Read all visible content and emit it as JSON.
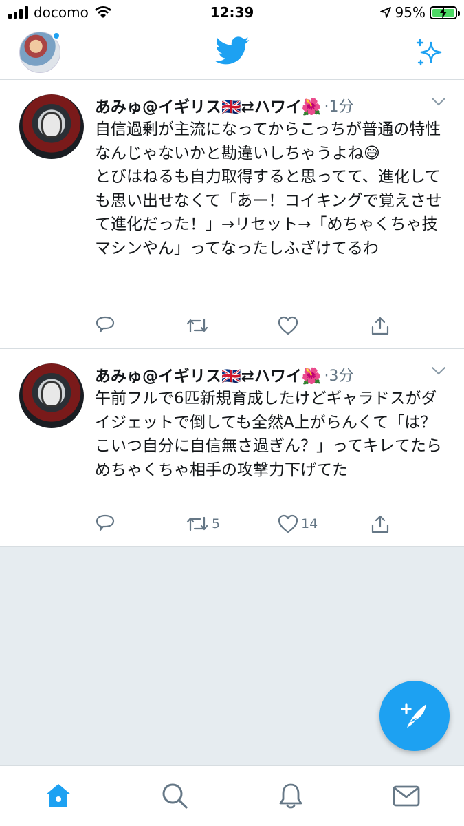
{
  "status_bar": {
    "carrier": "docomo",
    "time": "12:39",
    "battery_percent": "95%"
  },
  "header": {
    "logo": "twitter-bird-icon",
    "right_icon": "sparkle-icon"
  },
  "tweets": [
    {
      "display_name": "あみゅ@イギリス🇬🇧⇄ハワイ🌺",
      "timestamp": "·1分",
      "text": "自信過剰が主流になってからこっちが普通の特性なんじゃないかと勘違いしちゃうよね😅\nとびはねるも自力取得すると思ってて、進化しても思い出せなくて「あー！コイキングで覚えさせて進化だった！」→リセット→「めちゃくちゃ技マシンやん」ってなったしふざけてるわ",
      "retweets": "",
      "likes": ""
    },
    {
      "display_name": "あみゅ@イギリス🇬🇧⇄ハワイ🌺",
      "timestamp": "·3分",
      "text": "午前フルで6匹新規育成したけどギャラドスがダイジェットで倒しても全然A上がらんくて「は？こいつ自分に自信無さ過ぎん？」ってキレてたらめちゃくちゃ相手の攻撃力下げてた",
      "retweets": "5",
      "likes": "14"
    }
  ],
  "tab_bar": {
    "items": [
      "home-icon",
      "search-icon",
      "notifications-icon",
      "messages-icon"
    ],
    "active": "home-icon"
  },
  "colors": {
    "accent": "#1da1f2",
    "text": "#14171a",
    "secondary": "#657786",
    "background_empty": "#e6ecf0"
  }
}
